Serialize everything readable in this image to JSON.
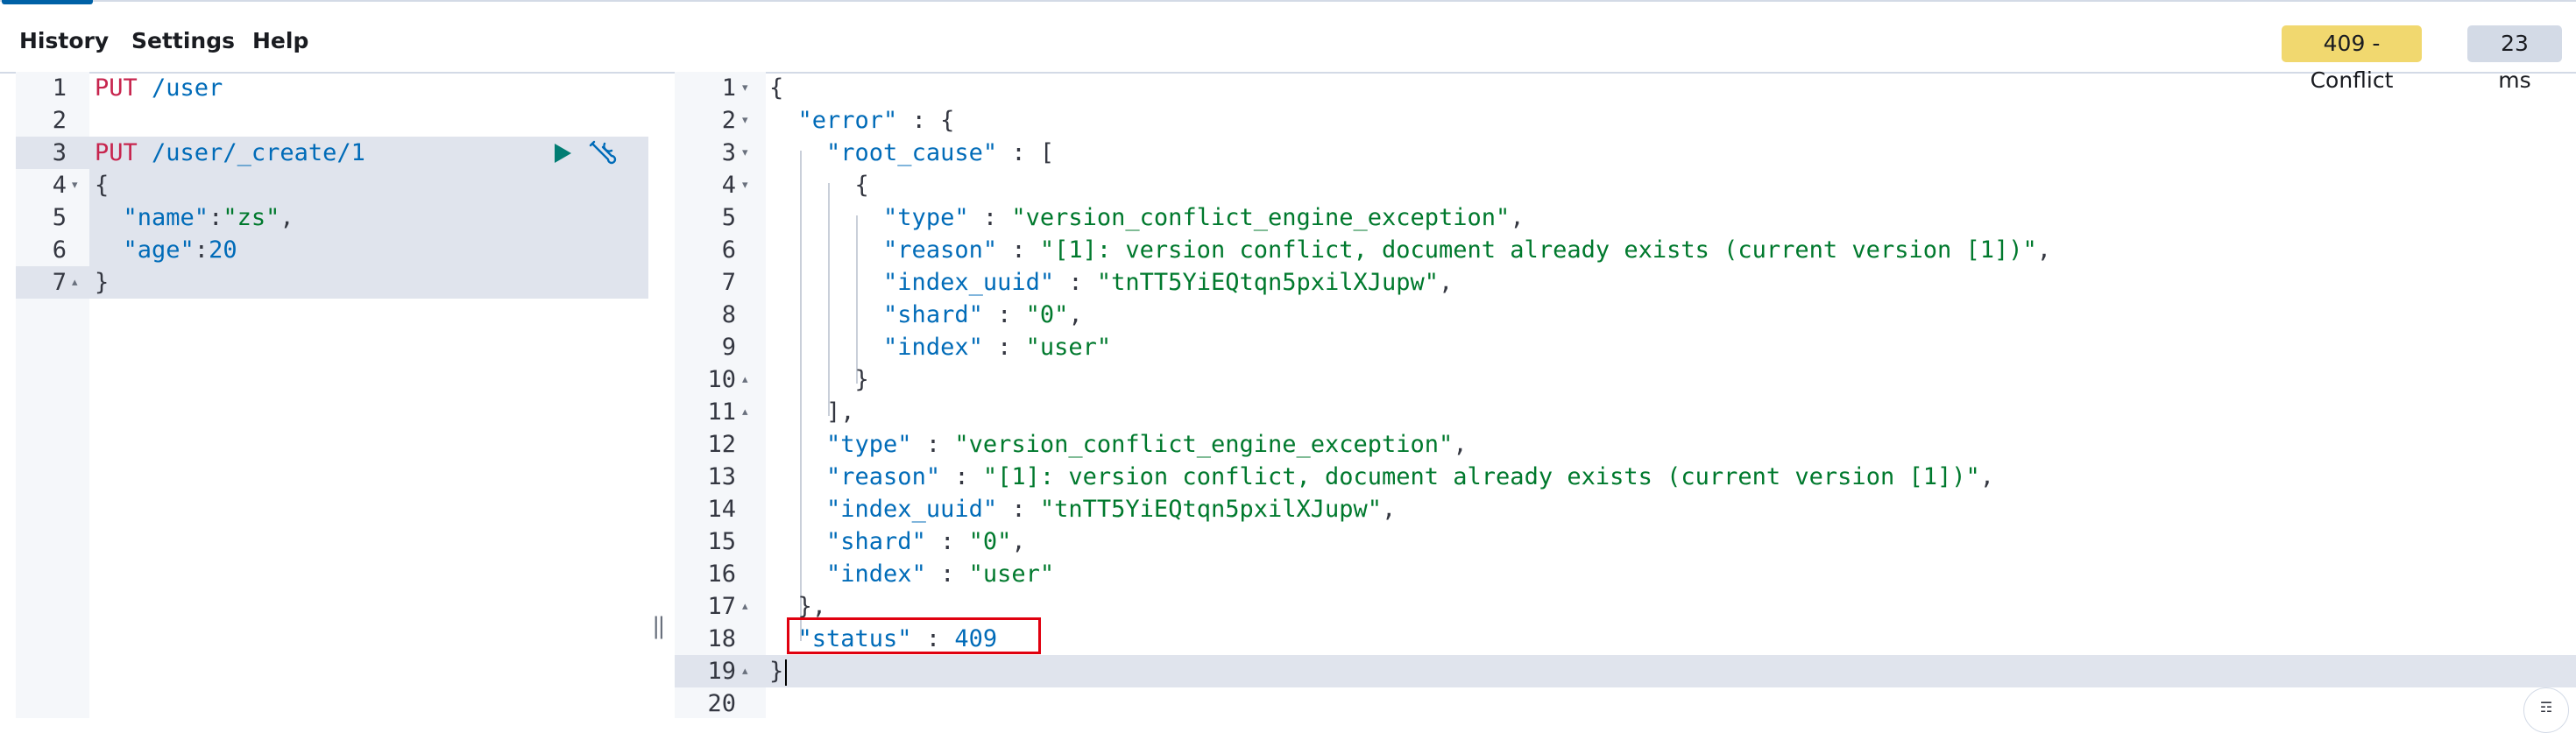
{
  "menu": {
    "history": "History",
    "settings": "Settings",
    "help": "Help"
  },
  "response_status": {
    "status_text": "409 - Conflict",
    "time": "23 ms",
    "status_color": "#f1d86f",
    "time_color": "#d3dae6"
  },
  "request": {
    "lines": [
      {
        "no": "1",
        "fold": ""
      },
      {
        "no": "2",
        "fold": ""
      },
      {
        "no": "3",
        "fold": ""
      },
      {
        "no": "4",
        "fold": "▾"
      },
      {
        "no": "5",
        "fold": ""
      },
      {
        "no": "6",
        "fold": ""
      },
      {
        "no": "7",
        "fold": "▴"
      }
    ],
    "line1_method": "PUT",
    "line1_url": " /user",
    "line3_method": "PUT",
    "line3_url": " /user/_create/1",
    "line4": "{",
    "line5_key": "\"name\"",
    "line5_colon": ":",
    "line5_val": "\"zs\"",
    "line5_end": ",",
    "line6_key": "\"age\"",
    "line6_colon": ":",
    "line6_val": "20",
    "line7": "}",
    "icons": {
      "run": "play-icon",
      "tools": "wrench-icon"
    }
  },
  "response": {
    "line_numbers": [
      "1",
      "2",
      "3",
      "4",
      "5",
      "6",
      "7",
      "8",
      "9",
      "10",
      "11",
      "12",
      "13",
      "14",
      "15",
      "16",
      "17",
      "18",
      "19",
      "20"
    ],
    "folds": [
      "▾",
      "▾",
      "▾",
      "▾",
      "",
      "",
      "",
      "",
      "",
      "▴",
      "▴",
      "",
      "",
      "",
      "",
      "",
      "▴",
      "",
      "▴",
      ""
    ],
    "l1": "{",
    "l2_key": "\"error\"",
    "l2_rest": " : {",
    "l3_key": "\"root_cause\"",
    "l3_rest": " : [",
    "l4": "{",
    "l5_key": "\"type\"",
    "l5_sep": " : ",
    "l5_val": "\"version_conflict_engine_exception\"",
    "l5_end": ",",
    "l6_key": "\"reason\"",
    "l6_sep": " : ",
    "l6_val": "\"[1]: version conflict, document already exists (current version [1])\"",
    "l6_end": ",",
    "l7_key": "\"index_uuid\"",
    "l7_sep": " : ",
    "l7_val": "\"tnTT5YiEQtqn5pxilXJupw\"",
    "l7_end": ",",
    "l8_key": "\"shard\"",
    "l8_sep": " : ",
    "l8_val": "\"0\"",
    "l8_end": ",",
    "l9_key": "\"index\"",
    "l9_sep": " : ",
    "l9_val": "\"user\"",
    "l10": "}",
    "l11": "],",
    "l12_key": "\"type\"",
    "l12_sep": " : ",
    "l12_val": "\"version_conflict_engine_exception\"",
    "l12_end": ",",
    "l13_key": "\"reason\"",
    "l13_sep": " : ",
    "l13_val": "\"[1]: version conflict, document already exists (current version [1])\"",
    "l13_end": ",",
    "l14_key": "\"index_uuid\"",
    "l14_sep": " : ",
    "l14_val": "\"tnTT5YiEQtqn5pxilXJupw\"",
    "l14_end": ",",
    "l15_key": "\"shard\"",
    "l15_sep": " : ",
    "l15_val": "\"0\"",
    "l15_end": ",",
    "l16_key": "\"index\"",
    "l16_sep": " : ",
    "l16_val": "\"user\"",
    "l17": "},",
    "l18_key": "\"status\"",
    "l18_sep": " : ",
    "l18_val": "409",
    "l19": "}"
  },
  "resizer_glyph": "‖",
  "corner_glyph": "☶"
}
